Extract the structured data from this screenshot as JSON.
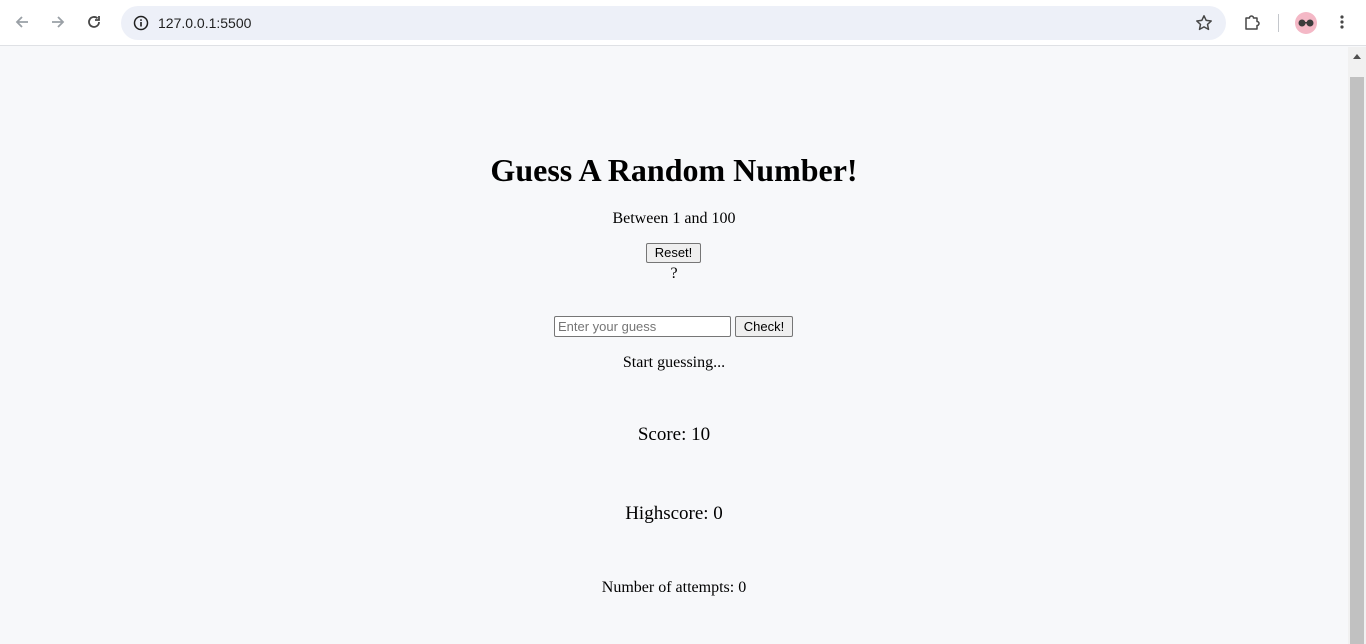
{
  "browser": {
    "url": "127.0.0.1:5500"
  },
  "game": {
    "title": "Guess A Random Number!",
    "range_text": "Between 1 and 100",
    "reset_label": "Reset!",
    "mystery_number": "?",
    "guess_placeholder": "Enter your guess",
    "guess_value": "",
    "check_label": "Check!",
    "message": "Start guessing...",
    "score_text": "Score: 10",
    "highscore_text": "Highscore: 0",
    "attempts_text": "Number of attempts: 0"
  }
}
